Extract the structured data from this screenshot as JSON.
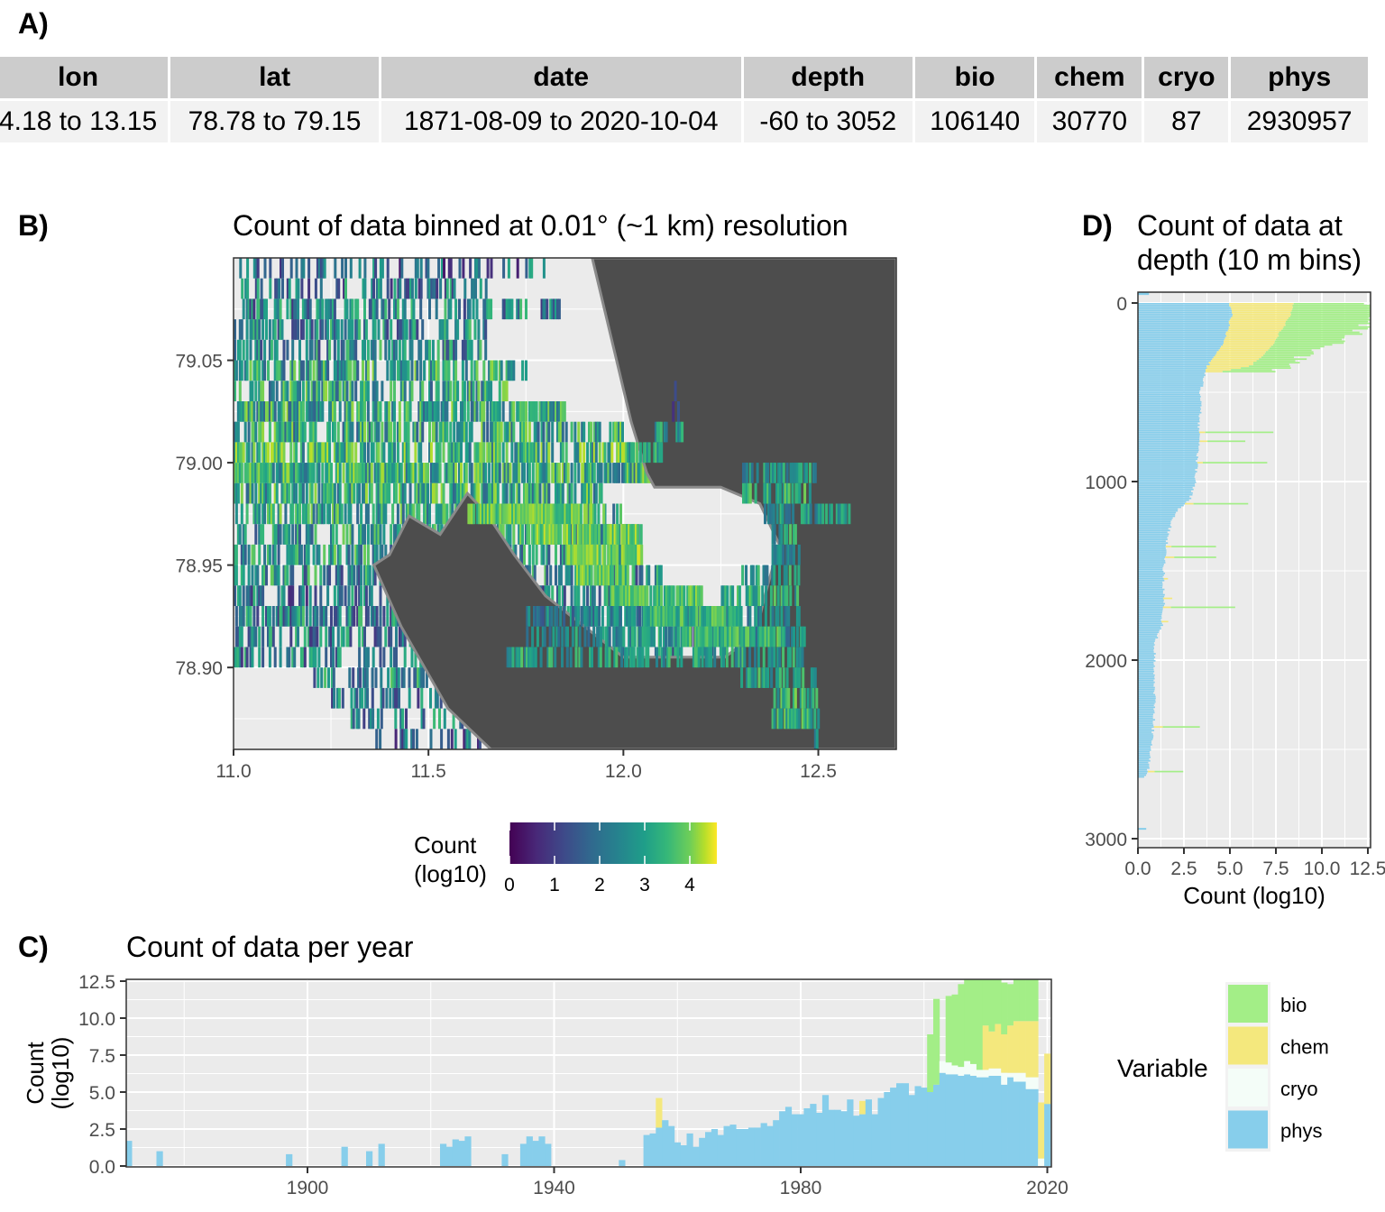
{
  "panels": {
    "a": {
      "label": "A)"
    },
    "b": {
      "label": "B)",
      "title": "Count of data binned at 0.01° (~1 km) resolution"
    },
    "c": {
      "label": "C)",
      "title": "Count of data per year"
    },
    "d": {
      "label": "D)",
      "title_line1": "Count of data at",
      "title_line2": "depth (10 m bins)"
    }
  },
  "summary_table": {
    "headers": [
      "lon",
      "lat",
      "date",
      "depth",
      "bio",
      "chem",
      "cryo",
      "phys"
    ],
    "row": [
      "4.18 to 13.15",
      "78.78 to 79.15",
      "1871-08-09 to 2020-10-04",
      "-60 to 3052",
      "106140",
      "30770",
      "87",
      "2930957"
    ]
  },
  "colors": {
    "bio": "#a3ee87",
    "chem": "#f4e87d",
    "cryo": "#f4fdf8",
    "phys": "#87ceeb",
    "land": "#4d4d4d",
    "panel_bg": "#ebebeb",
    "grid": "#ffffff"
  },
  "chart_data": [
    {
      "id": "map",
      "type": "heatmap",
      "title": "Count of data binned at 0.01° (~1 km) resolution",
      "xlabel": "",
      "ylabel": "",
      "xlim": [
        11.0,
        12.7
      ],
      "ylim": [
        78.86,
        79.1
      ],
      "x_ticks": [
        "11.0",
        "11.5",
        "12.0",
        "12.5"
      ],
      "x_tick_values": [
        11.0,
        11.5,
        12.0,
        12.5
      ],
      "y_ticks": [
        "78.90",
        "78.95",
        "79.00",
        "79.05"
      ],
      "y_tick_values": [
        78.9,
        78.95,
        79.0,
        79.05
      ],
      "legend": {
        "title_line1": "Count",
        "title_line2": "(log10)",
        "ticks": [
          "0",
          "1",
          "2",
          "3",
          "4"
        ],
        "range": [
          0,
          4.6
        ],
        "palette": "viridis",
        "placement": "bottom"
      },
      "land_polygon": [
        [
          11.92,
          79.1
        ],
        [
          11.97,
          79.06
        ],
        [
          12.02,
          79.02
        ],
        [
          12.06,
          78.995
        ],
        [
          12.08,
          78.988
        ],
        [
          12.25,
          78.988
        ],
        [
          12.35,
          78.98
        ],
        [
          12.4,
          78.96
        ],
        [
          12.37,
          78.94
        ],
        [
          12.35,
          78.925
        ],
        [
          12.33,
          78.915
        ],
        [
          12.26,
          78.905
        ],
        [
          12.0,
          78.905
        ],
        [
          11.8,
          78.935
        ],
        [
          11.72,
          78.955
        ],
        [
          11.65,
          78.975
        ],
        [
          11.6,
          78.985
        ],
        [
          11.53,
          78.965
        ],
        [
          11.45,
          78.974
        ],
        [
          11.4,
          78.955
        ],
        [
          11.36,
          78.95
        ],
        [
          11.43,
          78.92
        ],
        [
          11.55,
          78.88
        ],
        [
          11.66,
          78.86
        ],
        [
          12.7,
          78.86
        ],
        [
          12.7,
          79.1
        ]
      ],
      "cells_note": "binned data at 0.01 lon x 0.01 lat, values in log10 count",
      "cell_bands": [
        {
          "lat": 79.095,
          "lon_from": 11.01,
          "lon_to": 11.8,
          "density": 0.35,
          "mean": 1.6
        },
        {
          "lat": 79.085,
          "lon_from": 11.01,
          "lon_to": 11.65,
          "density": 0.45,
          "mean": 1.9
        },
        {
          "lat": 79.075,
          "lon_from": 11.0,
          "lon_to": 11.85,
          "density": 0.5,
          "mean": 2.0
        },
        {
          "lat": 79.065,
          "lon_from": 11.0,
          "lon_to": 11.65,
          "density": 0.55,
          "mean": 2.1
        },
        {
          "lat": 79.055,
          "lon_from": 11.0,
          "lon_to": 11.65,
          "density": 0.55,
          "mean": 2.2
        },
        {
          "lat": 79.045,
          "lon_from": 11.0,
          "lon_to": 11.75,
          "density": 0.65,
          "mean": 2.6
        },
        {
          "lat": 79.035,
          "lon_from": 11.0,
          "lon_to": 11.7,
          "density": 0.6,
          "mean": 2.6
        },
        {
          "lat": 79.025,
          "lon_from": 11.0,
          "lon_to": 11.85,
          "density": 0.75,
          "mean": 2.7
        },
        {
          "lat": 79.015,
          "lon_from": 11.0,
          "lon_to": 12.0,
          "density": 0.7,
          "mean": 2.6
        },
        {
          "lat": 79.005,
          "lon_from": 11.0,
          "lon_to": 12.05,
          "density": 0.75,
          "mean": 2.9
        },
        {
          "lat": 78.995,
          "lon_from": 11.0,
          "lon_to": 12.15,
          "density": 0.8,
          "mean": 2.8
        },
        {
          "lat": 78.985,
          "lon_from": 11.0,
          "lon_to": 11.95,
          "density": 0.75,
          "mean": 2.7
        },
        {
          "lat": 78.975,
          "lon_from": 11.0,
          "lon_to": 12.0,
          "density": 0.6,
          "mean": 2.6
        },
        {
          "lat": 78.965,
          "lon_from": 11.0,
          "lon_to": 12.05,
          "density": 0.55,
          "mean": 2.5
        },
        {
          "lat": 78.955,
          "lon_from": 11.0,
          "lon_to": 12.05,
          "density": 0.55,
          "mean": 2.4
        },
        {
          "lat": 78.945,
          "lon_from": 11.0,
          "lon_to": 12.1,
          "density": 0.55,
          "mean": 2.2
        },
        {
          "lat": 78.935,
          "lon_from": 11.0,
          "lon_to": 12.05,
          "density": 0.5,
          "mean": 1.8
        },
        {
          "lat": 78.925,
          "lon_from": 11.0,
          "lon_to": 12.2,
          "density": 0.55,
          "mean": 2.0
        },
        {
          "lat": 78.915,
          "lon_from": 11.0,
          "lon_to": 12.3,
          "density": 0.5,
          "mean": 2.0
        },
        {
          "lat": 78.905,
          "lon_from": 11.0,
          "lon_to": 12.3,
          "density": 0.45,
          "mean": 2.0
        },
        {
          "lat": 78.895,
          "lon_from": 11.2,
          "lon_to": 12.5,
          "density": 0.45,
          "mean": 2.2
        },
        {
          "lat": 78.885,
          "lon_from": 11.25,
          "lon_to": 12.5,
          "density": 0.4,
          "mean": 2.0
        },
        {
          "lat": 78.875,
          "lon_from": 11.3,
          "lon_to": 12.5,
          "density": 0.35,
          "mean": 1.9
        },
        {
          "lat": 78.865,
          "lon_from": 11.35,
          "lon_to": 12.5,
          "density": 0.3,
          "mean": 1.5
        }
      ]
    },
    {
      "id": "per-year",
      "type": "bar",
      "stacked": true,
      "title": "Count of data per year",
      "xlabel": "",
      "ylabel": "Count (log10)",
      "ylabel_line1": "Count",
      "ylabel_line2": "(log10)",
      "xlim": [
        1870.5,
        2021
      ],
      "ylim": [
        0,
        12.5
      ],
      "x_ticks": [
        "1900",
        "1940",
        "1980",
        "2020"
      ],
      "x_tick_values": [
        1900,
        1940,
        1980,
        2020
      ],
      "y_ticks": [
        "0.0",
        "2.5",
        "5.0",
        "7.5",
        "10.0",
        "12.5"
      ],
      "y_tick_values": [
        0,
        2.5,
        5,
        7.5,
        10,
        12.5
      ],
      "legend": {
        "title": "Variable",
        "entries": [
          "bio",
          "chem",
          "cryo",
          "phys"
        ],
        "placement": "right"
      },
      "series_order": [
        "phys",
        "cryo",
        "chem",
        "bio"
      ],
      "years": [
        1871,
        1876,
        1897,
        1906,
        1910,
        1912,
        1922,
        1923,
        1924,
        1925,
        1926,
        1932,
        1935,
        1936,
        1937,
        1938,
        1939,
        1951,
        1955,
        1956,
        1957,
        1958,
        1959,
        1960,
        1961,
        1962,
        1963,
        1964,
        1965,
        1966,
        1967,
        1968,
        1969,
        1970,
        1971,
        1972,
        1973,
        1974,
        1975,
        1976,
        1977,
        1978,
        1979,
        1980,
        1981,
        1982,
        1983,
        1984,
        1985,
        1986,
        1987,
        1988,
        1989,
        1990,
        1991,
        1992,
        1993,
        1994,
        1995,
        1996,
        1997,
        1998,
        1999,
        2000,
        2001,
        2002,
        2003,
        2004,
        2005,
        2006,
        2007,
        2008,
        2009,
        2010,
        2011,
        2012,
        2013,
        2014,
        2015,
        2016,
        2017,
        2018,
        2019,
        2020
      ],
      "series": [
        {
          "name": "phys",
          "values": [
            1.7,
            1.0,
            0.8,
            1.3,
            1.0,
            1.5,
            1.5,
            1.3,
            1.8,
            1.7,
            2.0,
            0.8,
            1.5,
            2.0,
            1.7,
            2.0,
            1.5,
            0.4,
            2.1,
            2.2,
            2.6,
            3.1,
            2.7,
            1.6,
            1.4,
            2.2,
            1.3,
            1.9,
            2.3,
            2.5,
            2.1,
            2.7,
            2.8,
            2.5,
            2.5,
            2.6,
            2.6,
            2.9,
            2.7,
            3.1,
            3.7,
            4.0,
            3.5,
            3.5,
            3.9,
            4.2,
            3.6,
            4.8,
            3.8,
            3.8,
            3.7,
            4.5,
            3.4,
            3.5,
            4.5,
            3.5,
            4.6,
            5.0,
            5.3,
            5.6,
            5.6,
            4.8,
            5.4,
            5.3,
            5.0,
            5.5,
            6.3,
            6.2,
            6.2,
            6.1,
            6.2,
            6.1,
            6.0,
            6.0,
            6.1,
            6.1,
            5.5,
            6.0,
            5.7,
            5.7,
            5.2,
            5.2,
            0.0,
            4.2
          ],
          "note": "log-count heights read from stacked chart"
        },
        {
          "name": "cryo",
          "values": [
            0,
            0,
            0,
            0,
            0,
            0,
            0,
            0,
            0,
            0,
            0,
            0,
            0,
            0,
            0,
            0,
            0,
            0,
            0,
            0,
            0,
            0,
            0,
            0,
            0,
            0,
            0,
            0,
            0,
            0,
            0,
            0,
            0,
            0,
            0,
            0,
            0,
            0,
            0,
            0,
            0,
            0,
            0,
            0,
            0,
            0,
            0,
            0,
            0,
            0,
            0,
            0,
            0,
            0,
            0,
            0,
            0,
            0,
            0,
            0,
            0,
            0,
            0,
            0,
            0,
            0,
            0.8,
            0.8,
            0.6,
            0.6,
            0.9,
            0.8,
            0.5,
            0.5,
            0.5,
            0.5,
            0.8,
            0.3,
            0.6,
            0.6,
            0.8,
            0.8,
            0.5,
            0
          ],
          "note": "stacked increment"
        },
        {
          "name": "chem",
          "values": [
            0,
            0,
            0,
            0,
            0,
            0,
            0,
            0,
            0,
            0,
            0,
            0,
            0,
            0,
            0,
            0,
            0,
            0,
            0,
            0,
            2.0,
            0,
            0,
            0,
            0,
            0,
            0,
            0,
            0,
            0,
            0,
            0,
            0,
            0,
            0,
            0,
            0,
            0,
            0,
            0,
            0,
            0,
            0,
            0,
            0,
            0,
            0,
            0,
            0,
            0,
            0,
            0,
            0,
            0.9,
            0,
            0,
            0,
            0,
            0,
            0,
            0,
            0,
            0,
            0,
            0,
            0,
            0,
            0,
            0,
            0,
            0,
            0,
            0,
            3.0,
            2.5,
            3.0,
            2.6,
            3.2,
            3.5,
            3.5,
            3.8,
            3.8,
            3.8,
            3.4
          ],
          "note": "stacked increment"
        },
        {
          "name": "bio",
          "values": [
            0,
            0,
            0,
            0,
            0,
            0,
            0,
            0,
            0,
            0,
            0,
            0,
            0,
            0,
            0,
            0,
            0,
            0,
            0,
            0,
            0,
            0,
            0,
            0,
            0,
            0,
            0,
            0,
            0,
            0,
            0,
            0,
            0,
            0,
            0,
            0,
            0,
            0,
            0,
            0,
            0,
            0,
            0,
            0,
            0,
            0,
            0,
            0,
            0,
            0,
            0,
            0,
            0,
            0,
            0,
            0,
            0,
            0,
            0,
            0,
            0,
            0,
            0,
            0,
            3.9,
            5.8,
            0,
            4.5,
            4.8,
            5.6,
            6.5,
            7.2,
            7.5,
            3.2,
            3.5,
            3.8,
            3.5,
            2.8,
            2.8,
            3.0,
            3.0,
            2.9,
            0,
            0
          ],
          "note": "stacked increment"
        }
      ]
    },
    {
      "id": "depth",
      "type": "bar",
      "orientation": "horizontal",
      "stacked": true,
      "title": "Count of data at depth (10 m bins)",
      "xlabel": "Count (log10)",
      "ylabel": "",
      "xlim": [
        0,
        12.5
      ],
      "ylim": [
        3100,
        -60
      ],
      "x_ticks": [
        "0.0",
        "2.5",
        "5.0",
        "7.5",
        "10.0",
        "12.5"
      ],
      "x_tick_values": [
        0,
        2.5,
        5,
        7.5,
        10,
        12.5
      ],
      "y_ticks": [
        "0",
        "1000",
        "2000",
        "3000"
      ],
      "y_tick_values": [
        0,
        1000,
        2000,
        3000
      ],
      "series_order": [
        "phys",
        "cryo",
        "chem",
        "bio"
      ],
      "profile_depths": [
        -60,
        0,
        50,
        100,
        150,
        200,
        250,
        300,
        350,
        400,
        450,
        500,
        600,
        700,
        800,
        900,
        1000,
        1100,
        1150,
        1200,
        1300,
        1400,
        1500,
        1600,
        1700,
        1800,
        1900,
        2000,
        2200,
        2300,
        2400,
        2500,
        2600,
        2650,
        2940,
        3050
      ],
      "series": [
        {
          "name": "phys",
          "values": [
            0.6,
            5.0,
            5.1,
            5.0,
            4.9,
            4.7,
            4.5,
            4.1,
            3.8,
            3.6,
            3.5,
            3.4,
            3.4,
            3.3,
            3.3,
            3.2,
            3.1,
            2.8,
            2.2,
            1.9,
            1.6,
            1.5,
            1.4,
            1.4,
            1.4,
            1.3,
            0.9,
            0.9,
            0.9,
            0.9,
            0.8,
            0.7,
            0.6,
            0.4,
            0.4,
            0.4
          ]
        },
        {
          "name": "chem",
          "values": [
            0,
            3.5,
            3.2,
            3.1,
            2.9,
            2.8,
            2.7,
            2.6,
            2.3,
            0,
            0.1,
            0,
            0,
            0.2,
            0.2,
            0,
            0.9,
            0,
            0.2,
            0,
            0.2,
            0,
            0,
            0,
            0,
            0,
            0,
            0,
            0,
            0.3,
            0,
            0,
            0,
            0,
            0,
            0
          ]
        },
        {
          "name": "bio",
          "values": [
            0,
            4.0,
            4.6,
            4.5,
            4.0,
            3.7,
            2.6,
            1.8,
            1.8,
            3.2,
            1.0,
            0,
            0,
            2.9,
            2.5,
            2.5,
            0,
            2.2,
            2.2,
            0,
            2.1,
            0,
            0,
            0,
            0,
            0,
            0,
            0,
            0,
            0,
            0,
            0,
            0,
            0,
            0,
            0
          ]
        }
      ]
    }
  ]
}
